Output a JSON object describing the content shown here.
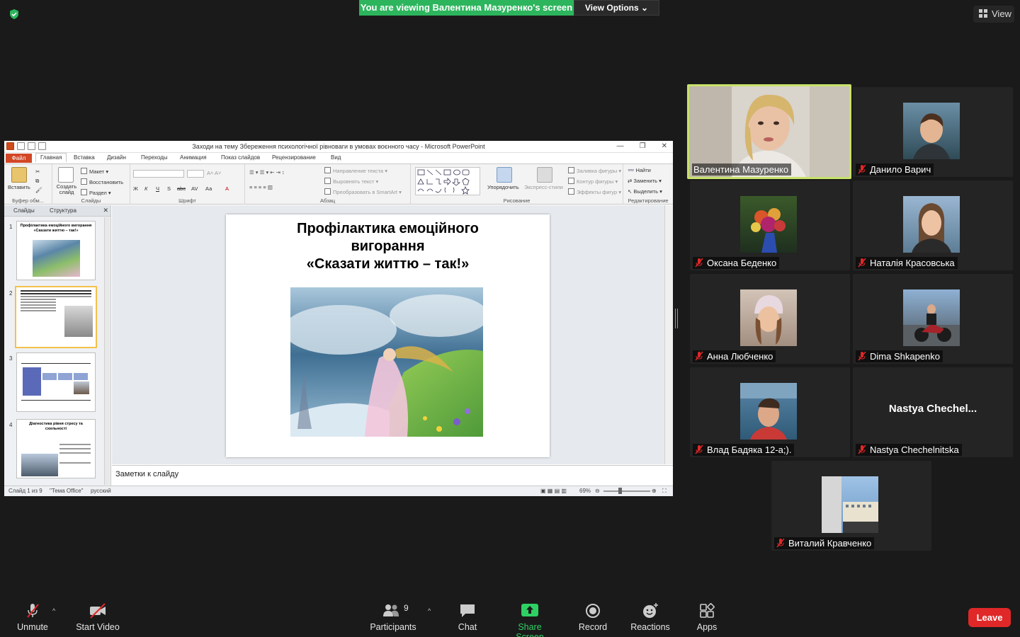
{
  "meeting": {
    "banner": "You are viewing Валентина Мазуренко's screen",
    "view_options": "View Options",
    "view_button": "View",
    "colors": {
      "banner": "#2db55d",
      "speaker_border": "#c7e26a",
      "leave": "#e02828",
      "share_screen": "#2fd063",
      "muted_icon": "#e02828"
    }
  },
  "ppt": {
    "window_title": "Заходи на тему Збереження психологічної рівноваги в умовах воєнного часу - Microsoft PowerPoint",
    "tabs": [
      "Файл",
      "Главная",
      "Вставка",
      "Дизайн",
      "Переходы",
      "Анимация",
      "Показ слайдов",
      "Рецензирование",
      "Вид"
    ],
    "ribbon": {
      "paste": "Вставить",
      "new_slide": "Создать слайд",
      "layout": "Макет",
      "reset": "Восстановить",
      "section": "Раздел",
      "groups": [
        "Буфер обм...",
        "Слайды",
        "Шрифт",
        "Абзац",
        "Рисование",
        "Редактирование"
      ],
      "text_direction": "Направление текста",
      "align_text": "Выровнять текст",
      "smartart": "Преобразовать в SmartArt",
      "arrange": "Упорядочить",
      "quick_styles": "Экспресс-стили",
      "shape_fill": "Заливка фигуры",
      "shape_outline": "Контур фигуры",
      "shape_effects": "Эффекты фигур",
      "find": "Найти",
      "replace": "Заменить",
      "select": "Выделить",
      "font_buttons": [
        "Ж",
        "К",
        "Ч",
        "S",
        "abc",
        "AV",
        "Аа",
        "A"
      ]
    },
    "pane_tabs": [
      "Слайды",
      "Структура"
    ],
    "thumbs": [
      {
        "num": "1",
        "title": "Профілактика емоційного вигорання «Сказати життю – так!»"
      },
      {
        "num": "2",
        "title": ""
      },
      {
        "num": "3",
        "title": ""
      },
      {
        "num": "4",
        "title": "Діагностика рівня стресу та схильності"
      }
    ],
    "slide_title_lines": [
      "Профілактика емоційного",
      "вигорання",
      "«Сказати життю – так!»"
    ],
    "notes_placeholder": "Заметки к слайду",
    "status": {
      "slide": "Слайд 1 из 9",
      "theme": "\"Тема Office\"",
      "language": "русский",
      "zoom": "69%"
    }
  },
  "participants": [
    {
      "name": "Валентина Мазуренко",
      "muted": false,
      "speaker": true,
      "video": true
    },
    {
      "name": "Данило Варич",
      "muted": true,
      "speaker": false,
      "video": true
    },
    {
      "name": "Оксана Беденко",
      "muted": true,
      "speaker": false,
      "video": true
    },
    {
      "name": "Наталія Красовська",
      "muted": true,
      "speaker": false,
      "video": true
    },
    {
      "name": "Анна Любченко",
      "muted": true,
      "speaker": false,
      "video": true
    },
    {
      "name": "Dima Shkapenko",
      "muted": true,
      "speaker": false,
      "video": true
    },
    {
      "name": "Влад Бадяка 12-а;).",
      "muted": true,
      "speaker": false,
      "video": true
    },
    {
      "name": "Nastya Chechelnitska",
      "muted": true,
      "speaker": false,
      "video": false,
      "display_name": "Nastya  Chechel..."
    },
    {
      "name": "Виталий Кравченко",
      "muted": true,
      "speaker": false,
      "video": true
    }
  ],
  "toolbar": {
    "unmute": "Unmute",
    "start_video": "Start Video",
    "participants": "Participants",
    "participants_count": "9",
    "chat": "Chat",
    "share_screen": "Share Screen",
    "record": "Record",
    "reactions": "Reactions",
    "apps": "Apps",
    "leave": "Leave"
  }
}
